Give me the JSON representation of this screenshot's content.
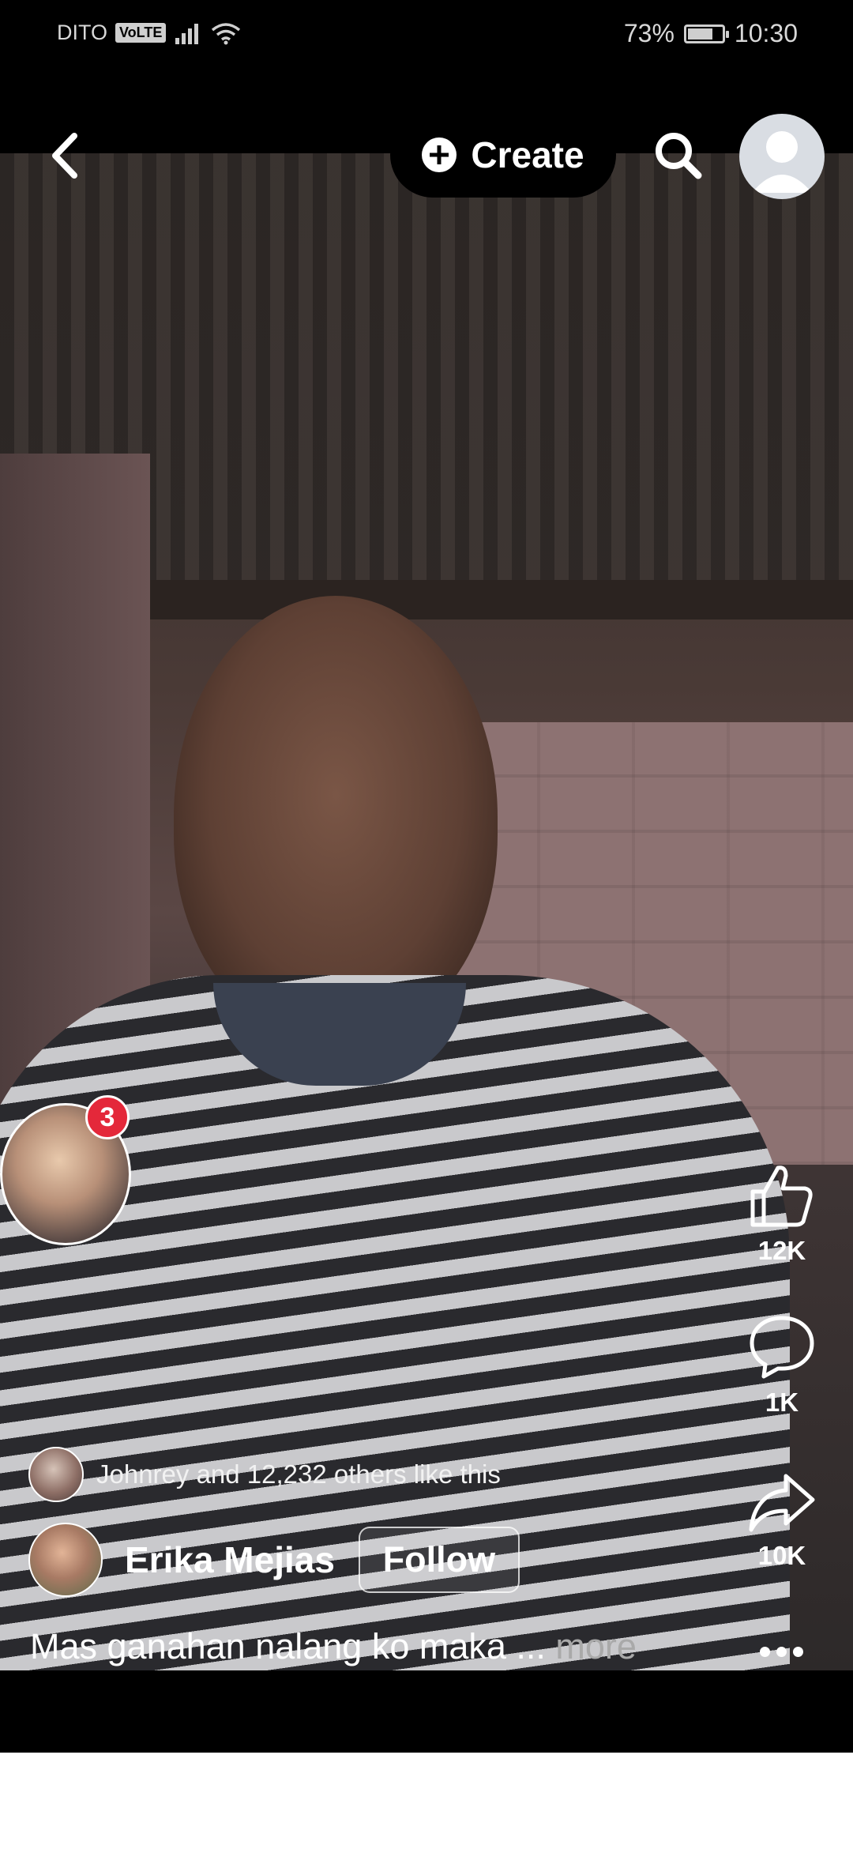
{
  "status_bar": {
    "carrier": "DITO",
    "volte": "VoLTE",
    "battery_percent": "73%",
    "battery_level": 0.73,
    "time": "10:30"
  },
  "header": {
    "create_label": "Create",
    "icons": [
      "back-arrow-icon",
      "plus-circle-icon",
      "search-icon",
      "profile-avatar"
    ]
  },
  "story": {
    "badge_count": "3"
  },
  "actions": {
    "like_count": "12K",
    "comment_count": "1K",
    "share_count": "10K"
  },
  "post": {
    "likes_text": "Johnrey and 12,232 others like this",
    "author_name": "Erika Mejias",
    "follow_label": "Follow",
    "caption": "Mas ganahan nalang ko maka ... ",
    "caption_more": "more"
  },
  "colors": {
    "badge_red": "#e4283a",
    "background": "#000000"
  }
}
